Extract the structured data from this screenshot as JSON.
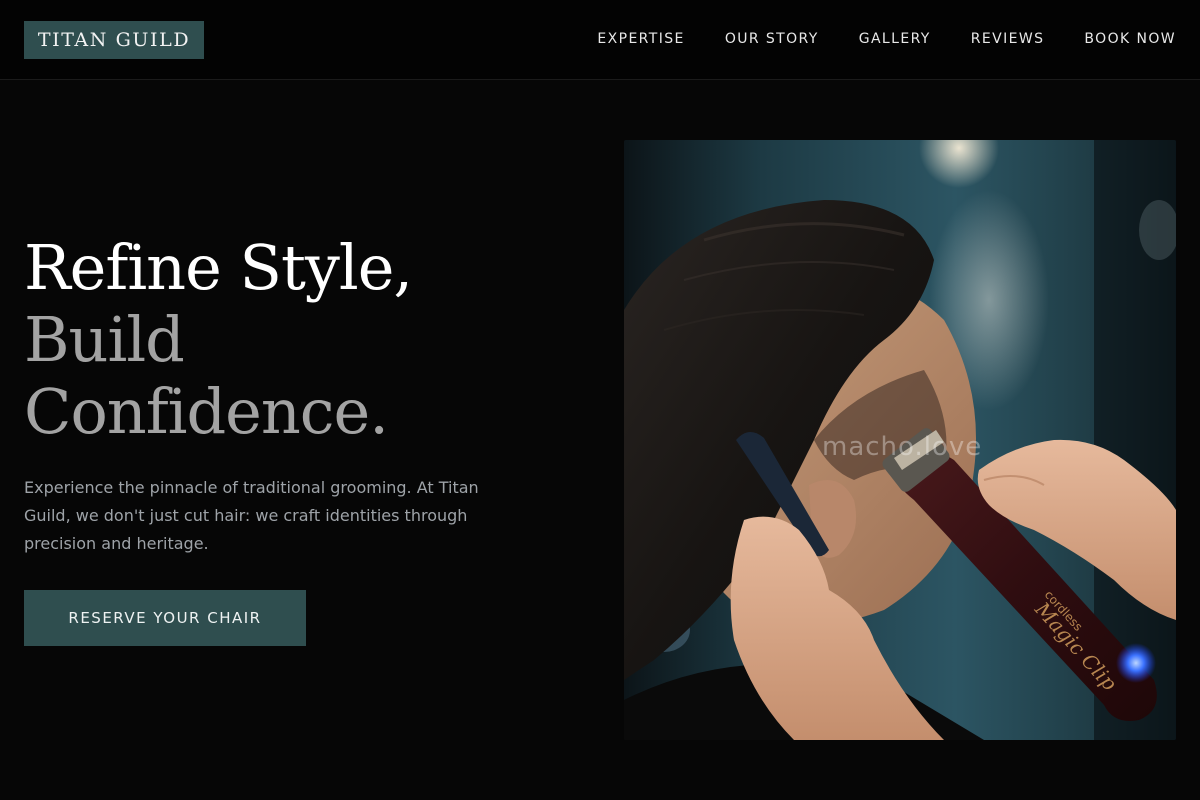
{
  "header": {
    "logo": "TITAN GUILD",
    "nav": [
      "EXPERTISE",
      "OUR STORY",
      "GALLERY",
      "REVIEWS",
      "BOOK NOW"
    ]
  },
  "hero": {
    "title_line1": "Refine Style,",
    "title_line2": "Build",
    "title_line3": "Confidence.",
    "description": "Experience the pinnacle of traditional grooming. At Titan Guild, we don't just cut hair: we craft identities through precision and heritage.",
    "cta_label": "RESERVE YOUR CHAIR"
  },
  "photo": {
    "subject": "barber trimming a client's hair with cordless clippers",
    "clipper_brand": "Magic Clip",
    "clipper_subtext": "cordless",
    "watermark": "macho.love"
  },
  "colors": {
    "accent": "#2f4e4f",
    "background": "#060606",
    "header_background": "#030303",
    "title_white": "#ffffff",
    "title_gray": "#a3a3a3",
    "body_text": "#9ea3a8"
  }
}
